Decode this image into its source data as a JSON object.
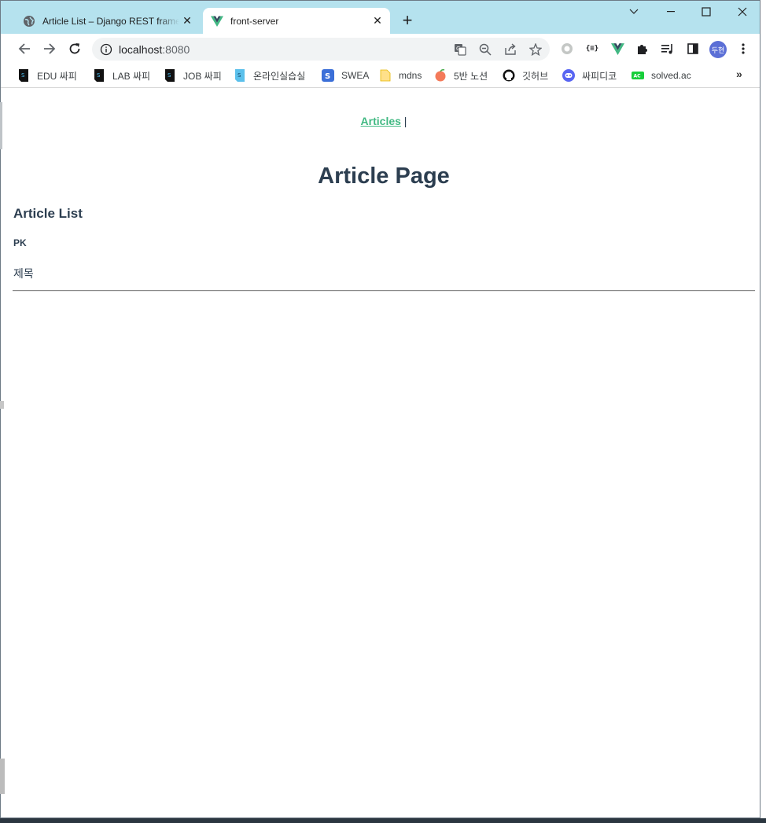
{
  "browser": {
    "tabs": [
      {
        "title": "Article List – Django REST frame",
        "icon": "globe-icon",
        "close": "✕",
        "active": false
      },
      {
        "title": "front-server",
        "icon": "vue-logo-icon",
        "close": "✕",
        "active": true
      }
    ],
    "new_tab": "+",
    "address": {
      "host": "localhost",
      "port": ":8080"
    },
    "profile_initial": "두현",
    "bookmarks": [
      {
        "label": "EDU 싸피",
        "icon": "ssafy-icon"
      },
      {
        "label": "LAB 싸피",
        "icon": "ssafy-icon"
      },
      {
        "label": "JOB 싸피",
        "icon": "ssafy-icon"
      },
      {
        "label": "온라인실습실",
        "icon": "ssafy-online-icon"
      },
      {
        "label": "SWEA",
        "icon": "swea-icon"
      },
      {
        "label": "mdns",
        "icon": "folder-icon"
      },
      {
        "label": "5반 노션",
        "icon": "peach-icon"
      },
      {
        "label": "깃허브",
        "icon": "github-icon"
      },
      {
        "label": "싸피디코",
        "icon": "discord-icon"
      },
      {
        "label": "solved.ac",
        "icon": "solvedac-icon"
      }
    ],
    "bookmarks_more": "»"
  },
  "page": {
    "nav_link": "Articles",
    "nav_separator": " |",
    "heading": "Article Page",
    "subheading": "Article List",
    "pk_label": "PK",
    "title_label": "제목"
  },
  "colors": {
    "tabstrip": "#b5e2ee",
    "link": "#42b983",
    "text": "#2c3e50"
  }
}
